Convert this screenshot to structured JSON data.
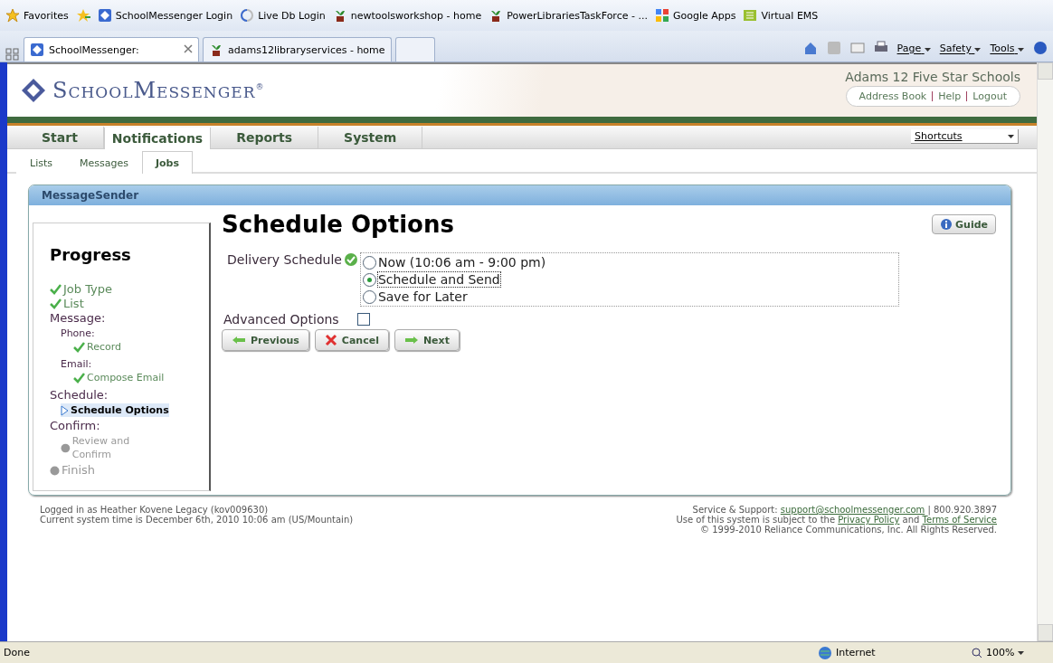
{
  "browser": {
    "favorites_label": "Favorites",
    "favorites": [
      {
        "label": "SchoolMessenger Login",
        "kind": "site"
      },
      {
        "label": "Live Db Login",
        "kind": "ring"
      },
      {
        "label": "newtoolsworkshop - home",
        "kind": "plant"
      },
      {
        "label": "PowerLibrariesTaskForce - ...",
        "kind": "plant"
      },
      {
        "label": "Google Apps",
        "kind": "apps"
      },
      {
        "label": "Virtual EMS",
        "kind": "ems"
      }
    ],
    "tabs": [
      {
        "label": "SchoolMessenger:",
        "selected": true,
        "kind": "site"
      },
      {
        "label": "adams12libraryservices - home",
        "selected": false,
        "kind": "plant"
      }
    ],
    "commands": [
      "Page",
      "Safety",
      "Tools"
    ],
    "status": "Done",
    "zone": "Internet",
    "zoom": "100%"
  },
  "header": {
    "logo": "SchoolMessenger$^{®}$",
    "org": "Adams 12 Five Star Schools",
    "links": [
      "Address Book",
      "Help",
      "Logout"
    ]
  },
  "nav": {
    "tabs": [
      {
        "label": "Start",
        "selected": false
      },
      {
        "label": "Notifications",
        "selected": true
      },
      {
        "label": "Reports",
        "selected": false
      },
      {
        "label": "System",
        "selected": false
      }
    ],
    "shortcuts": "Shortcuts",
    "subtabs": [
      {
        "label": "Lists",
        "selected": false
      },
      {
        "label": "Messages",
        "selected": false
      },
      {
        "label": "Jobs",
        "selected": true
      }
    ]
  },
  "panel": {
    "title": "MessageSender",
    "progress": {
      "heading": "Progress",
      "steps": [
        {
          "label": "Job Type",
          "kind": "done"
        },
        {
          "label": "List",
          "kind": "done"
        },
        {
          "label": "Message:",
          "kind": "section",
          "children": [
            {
              "label": "Phone:",
              "kind": "group",
              "children": [
                {
                  "label": "Record",
                  "kind": "done"
                }
              ]
            },
            {
              "label": "Email:",
              "kind": "group",
              "children": [
                {
                  "label": "Compose Email",
                  "kind": "done"
                }
              ]
            }
          ]
        },
        {
          "label": "Schedule:",
          "kind": "section",
          "children": [
            {
              "label": "Schedule Options",
              "kind": "current"
            }
          ]
        },
        {
          "label": "Confirm:",
          "kind": "section",
          "children": [
            {
              "label": "Review and Confirm",
              "kind": "pending"
            }
          ]
        },
        {
          "label": "Finish",
          "kind": "pending"
        }
      ]
    },
    "heading": "Schedule Options",
    "guide": "Guide",
    "delivery": {
      "label": "Delivery Schedule",
      "options": [
        {
          "label": "Now (10:06 am - 9:00 pm)",
          "selected": false
        },
        {
          "label": "Schedule and Send",
          "selected": true
        },
        {
          "label": "Save for Later",
          "selected": false
        }
      ]
    },
    "advanced": {
      "label": "Advanced Options",
      "checked": false
    },
    "buttons": [
      {
        "label": "Previous",
        "kind": "back"
      },
      {
        "label": "Cancel",
        "kind": "cancel"
      },
      {
        "label": "Next",
        "kind": "next"
      }
    ]
  },
  "footer": {
    "left": [
      "Logged in as Heather Kovene Legacy (kov009630)",
      "Current system time is December 6th, 2010 10:06 am (US/Mountain)"
    ],
    "right": [
      [
        {
          "text": "Service & Support: "
        },
        {
          "link": "support@schoolmessenger.com"
        },
        {
          "text": " | 800.920.3897"
        }
      ],
      [
        {
          "text": "Use of this system is subject to the "
        },
        {
          "link": "Privacy Policy"
        },
        {
          "text": " and "
        },
        {
          "link": "Terms of Service"
        }
      ],
      [
        {
          "text": "© 1999-2010 Reliance Communications, Inc. All Rights Reserved."
        }
      ]
    ]
  }
}
